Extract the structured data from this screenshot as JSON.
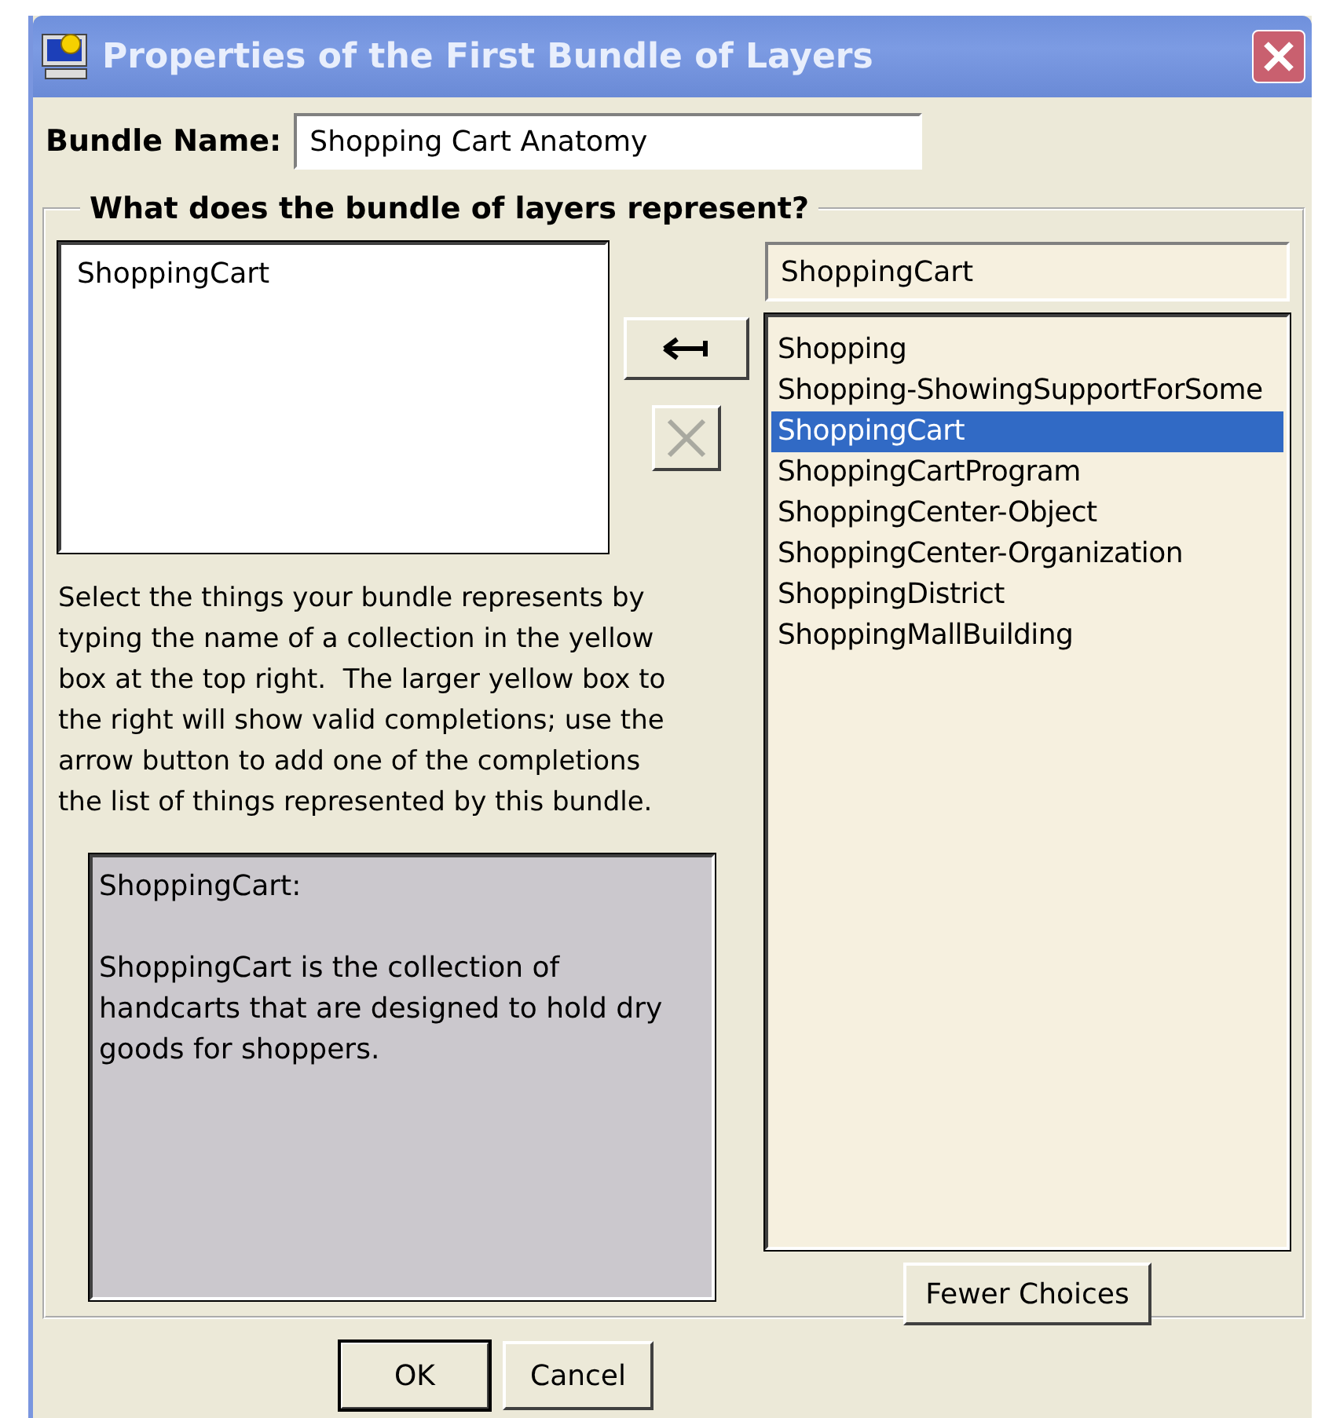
{
  "window": {
    "title": "Properties of the First Bundle of Layers"
  },
  "bundle_name": {
    "label": "Bundle Name:",
    "value": "Shopping Cart Anatomy"
  },
  "group": {
    "title": "What does the bundle of layers represent?"
  },
  "represented": [
    {
      "label": "ShoppingCart"
    }
  ],
  "remove_button": {
    "disabled": true
  },
  "search": {
    "value": "ShoppingCart"
  },
  "completions": [
    {
      "label": "Shopping",
      "selected": false
    },
    {
      "label": "Shopping-ShowingSupportForSome",
      "selected": false
    },
    {
      "label": "ShoppingCart",
      "selected": true
    },
    {
      "label": "ShoppingCartProgram",
      "selected": false
    },
    {
      "label": "ShoppingCenter-Object",
      "selected": false
    },
    {
      "label": "ShoppingCenter-Organization",
      "selected": false
    },
    {
      "label": "ShoppingDistrict",
      "selected": false
    },
    {
      "label": "ShoppingMallBuilding",
      "selected": false
    }
  ],
  "help_text": "Select the things your bundle represents by typing the name of a collection in the yellow box at the top right.  The larger yellow box to the right will show valid completions; use the arrow button to add one of the completions the list of things represented by this bundle.",
  "description": {
    "heading": "ShoppingCart:",
    "body": "ShoppingCart is the collection of handcarts that are designed to hold dry goods for shoppers."
  },
  "fewer_choices_button": {
    "label": "Fewer Choices"
  },
  "buttons": [
    {
      "label": "OK",
      "default": true
    },
    {
      "label": "Cancel",
      "default": false
    }
  ]
}
